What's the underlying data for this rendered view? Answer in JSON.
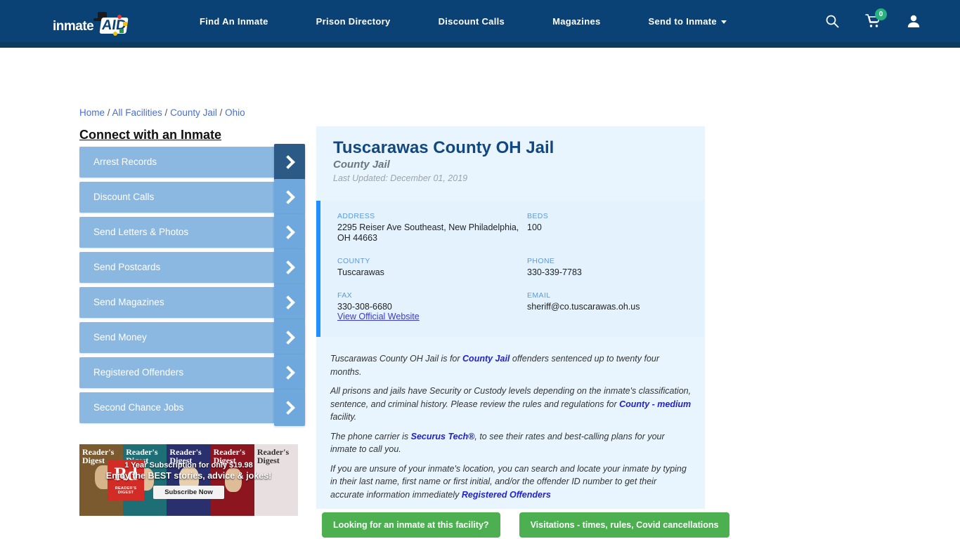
{
  "header": {
    "logo": {
      "text": "inmate",
      "aid": "AID",
      "alt": "inmate-aid-logo"
    },
    "nav": [
      {
        "label": "Find An Inmate",
        "dropdown": false
      },
      {
        "label": "Prison Directory",
        "dropdown": false
      },
      {
        "label": "Discount Calls",
        "dropdown": false
      },
      {
        "label": "Magazines",
        "dropdown": false
      },
      {
        "label": "Send to Inmate",
        "dropdown": true
      }
    ],
    "icons": [
      {
        "name": "search-icon"
      },
      {
        "name": "cart-icon",
        "badge": "0"
      },
      {
        "name": "user-account-icon"
      }
    ],
    "bg_color": "#0a4275",
    "badge_color": "#26b37f"
  },
  "breadcrumb": {
    "items": [
      "Home",
      "All Facilities",
      "County Jail",
      "Ohio"
    ],
    "separator": "/"
  },
  "sidebar": {
    "title": "Connect with an Inmate",
    "items": [
      {
        "label": "Arrest Records",
        "active": true
      },
      {
        "label": "Discount Calls",
        "active": false
      },
      {
        "label": "Send Letters & Photos",
        "active": false
      },
      {
        "label": "Send Postcards",
        "active": false
      },
      {
        "label": "Send Magazines",
        "active": false
      },
      {
        "label": "Send Money",
        "active": false
      },
      {
        "label": "Registered Offenders",
        "active": false
      },
      {
        "label": "Second Chance Jobs",
        "active": false
      }
    ]
  },
  "ad": {
    "brand": "Reader's Digest",
    "rd_mark": "Rd",
    "rd_sub": "READER'S DIGEST",
    "line1": "1 Year Subscription for only $19.98",
    "line2": "Enjoy the BEST stories, advice & jokes!",
    "button": "Subscribe Now"
  },
  "facility": {
    "title": "Tuscarawas County OH Jail",
    "type": "County Jail",
    "last_updated": "Last Updated: December 01, 2019",
    "info": [
      {
        "label": "ADDRESS",
        "value": "2295 Reiser Ave Southeast, New Philadelphia, OH 44663"
      },
      {
        "label": "BEDS",
        "value": "100"
      },
      {
        "label": "COUNTY",
        "value": "Tuscarawas"
      },
      {
        "label": "PHONE",
        "value": "330-339-7783"
      },
      {
        "label": "FAX",
        "value": "330-308-6680"
      },
      {
        "label": "EMAIL",
        "value": "sheriff@co.tuscarawas.oh.us"
      }
    ],
    "official_website_link": "View Official Website",
    "accent_color": "#1e90ff",
    "panel_bg": "#e9f5fe"
  },
  "description": {
    "p1_a": "Tuscarawas County OH Jail is for ",
    "p1_link": "County Jail",
    "p1_b": " offenders sentenced up to twenty four months.",
    "p2_a": "All prisons and jails have Security or Custody levels depending on the inmate's classification, sentence, and criminal history. Please review the rules and regulations for ",
    "p2_link": "County - medium",
    "p2_b": " facility.",
    "p3_a": "The phone carrier is ",
    "p3_link": "Securus Tech®",
    "p3_b": ", to see their rates and best-calling plans for your inmate to call you.",
    "p4_a": "If you are unsure of your inmate's location, you can search and locate your inmate by typing in their last name, first name or first initial, and/or the offender ID number to get their accurate information immediately ",
    "p4_link": "Registered Offenders"
  },
  "cta": {
    "primary": "Looking for an inmate at this facility?",
    "secondary": "Visitations - times, rules, Covid cancellations",
    "color": "#4caf50"
  }
}
